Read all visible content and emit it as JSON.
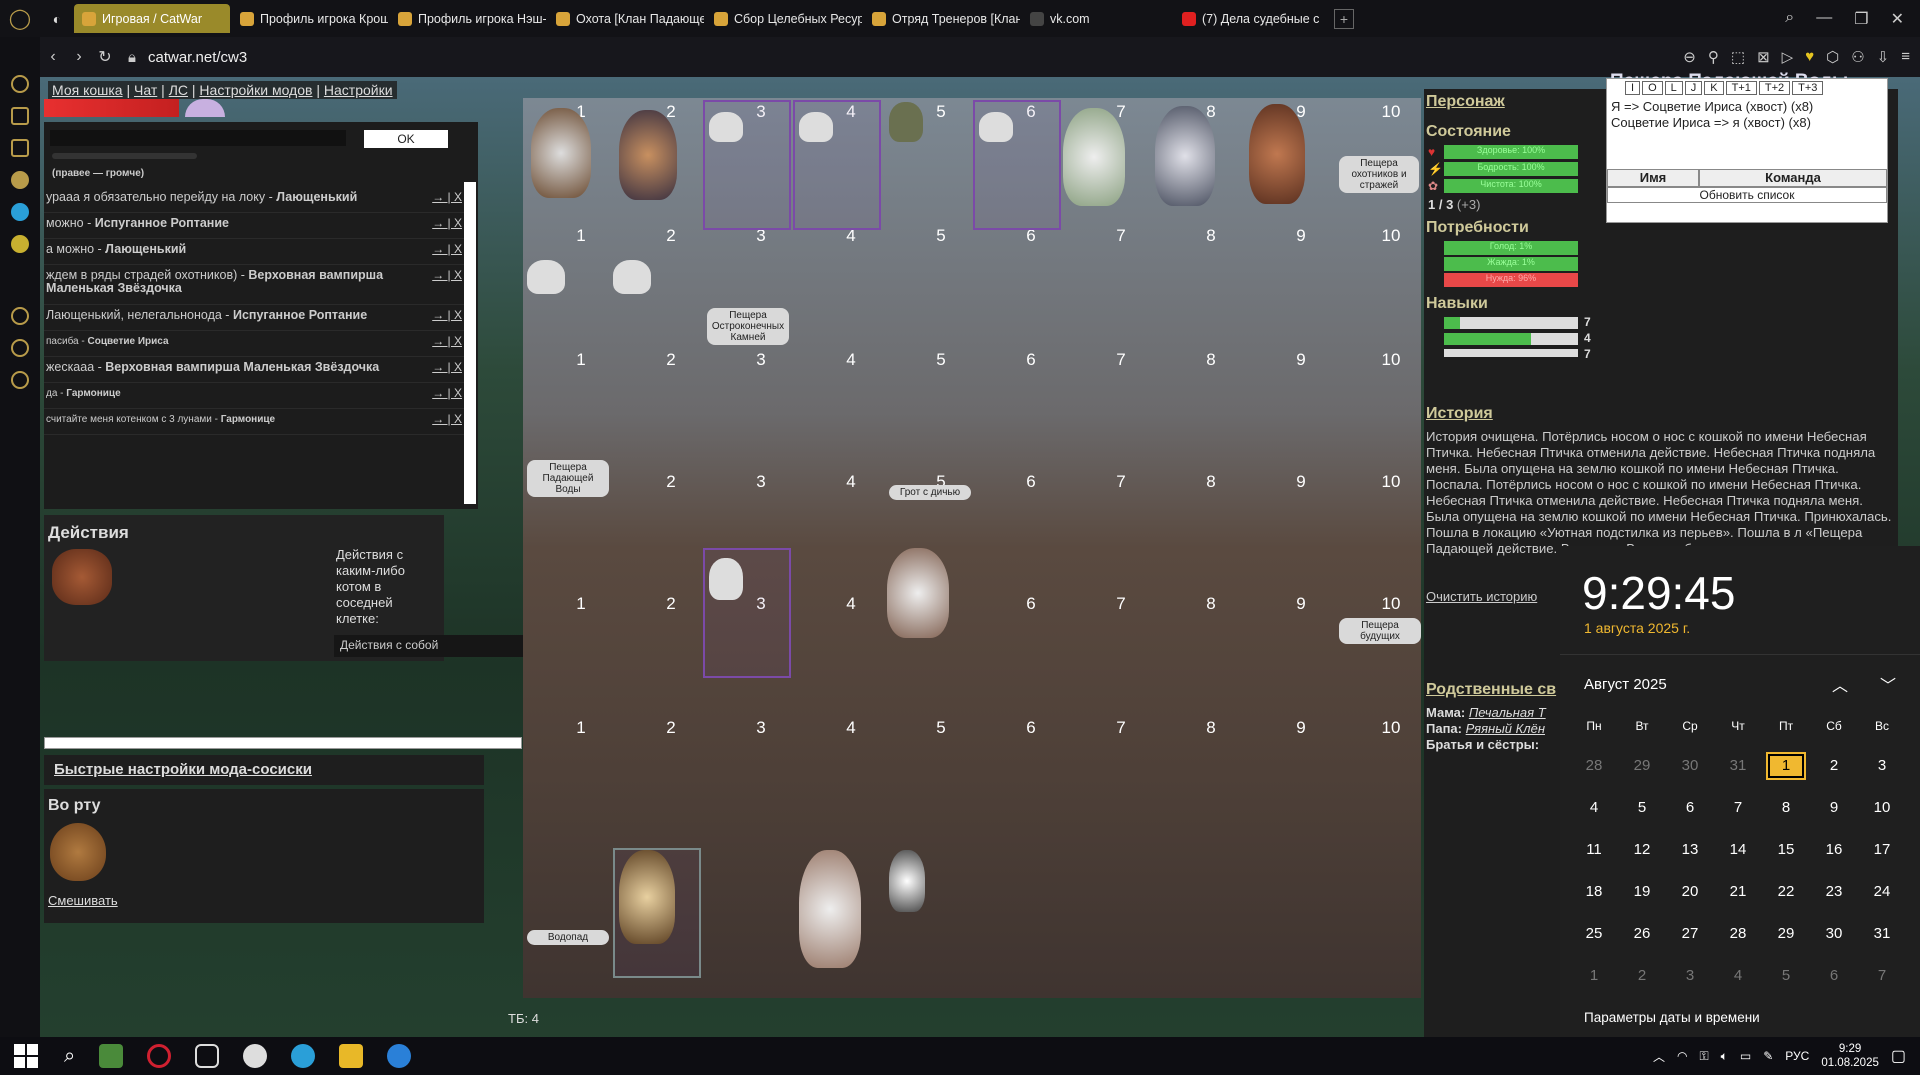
{
  "browser": {
    "tabs": [
      {
        "label": "Игровая / CatWar",
        "active": true,
        "color": "#d8a43a"
      },
      {
        "label": "Профиль игрока Крошка",
        "active": false,
        "color": "#d8a43a"
      },
      {
        "label": "Профиль игрока Нэш-Ко",
        "active": false,
        "color": "#d8a43a"
      },
      {
        "label": "Охота [Клан Падающей В",
        "active": false,
        "color": "#d8a43a"
      },
      {
        "label": "Сбор Целебных Ресурсо",
        "active": false,
        "color": "#d8a43a"
      },
      {
        "label": "Отряд Тренеров [Клан П",
        "active": false,
        "color": "#d8a43a"
      },
      {
        "label": "vk.com",
        "active": false,
        "color": "#444"
      },
      {
        "label": "(7) Дела судебные с",
        "active": false,
        "color": "#e02020"
      }
    ],
    "url": "catwar.net/cw3"
  },
  "topnav": [
    "Моя кошка",
    "Чат",
    "ЛС",
    "Настройки модов",
    "Настройки"
  ],
  "chat": {
    "ok_label": "OK",
    "volume_hint": "(правее — громче)",
    "messages": [
      {
        "text": "урааа я обязательно перейду на локу - ",
        "author": "Лающенький"
      },
      {
        "text": "можно - ",
        "author": "Испуганное Роптание"
      },
      {
        "text": "а можно - ",
        "author": "Лающенький"
      },
      {
        "text": "ждем в ряды страдей охотников) - ",
        "author": "Верховная вампирша Маленькая Звёздочка"
      },
      {
        "text": "Лающенький, нелегальнонода - ",
        "author": "Испуганное Роптание"
      },
      {
        "text": "пасиба - ",
        "author": "Соцветие Ириса"
      },
      {
        "text": "жескааа - ",
        "author": "Верховная вампирша Маленькая Звёздочка"
      },
      {
        "text": "да - ",
        "author": "Гармонице"
      },
      {
        "text": "считайте меня котенком с 3 лунами - ",
        "author": "Гармонице"
      }
    ],
    "action_icons": "→ | X"
  },
  "actions": {
    "title": "Действия",
    "desc": "Действия с каким-либо котом в соседней клетке:",
    "self_button": "Действия с собой"
  },
  "mod_settings": "Быстрые настройки мода-сосиски",
  "mouth": {
    "title": "Во рту",
    "mix": "Смешивать"
  },
  "field": {
    "row_numbers": [
      "1",
      "2",
      "3",
      "4",
      "5",
      "6",
      "7",
      "8",
      "9",
      "10"
    ],
    "locations": [
      "Пещера охотников и стражей",
      "Пещера Остроконечных Камней",
      "Пещера Падающей Воды",
      "Грот с дичью",
      "Пещера будущих",
      "Водопад"
    ],
    "tb": "ТБ: 4"
  },
  "character": {
    "title": "Персонаж",
    "state": "Состояние",
    "health": "Здоровье: 100%",
    "energy": "Бодрость: 100%",
    "clean": "Чистота: 100%",
    "count": "1 / 3",
    "count_extra": "(+3)",
    "needs": "Потребности",
    "hunger": "Голод: 1%",
    "thirst": "Жажда: 1%",
    "need": "Нужда: 96%",
    "skills": "Навыки",
    "skill_values": [
      "7",
      "4",
      "7"
    ],
    "history": "История",
    "history_text": "История очищена. Потёрлись носом о нос с кошкой по имени Небесная Птичка. Небесная Птичка отменила действие. Небесная Птичка подняла меня. Была опущена на землю кошкой по имени Небесная Птичка. Поспала. Потёрлись носом о нос с кошкой по имени Небесная Птичка. Небесная Птичка отменила действие. Небесная Птичка подняла меня. Была опущена на землю кошкой по имени Небесная Птичка. Принюхалась. Пошла в локацию «Уютная подстилка из перьев». Пошла в л «Пещера Падающей действие. Вылизала Встала в боевую сто",
    "clear_history": "Очистить историю",
    "relatives": "Родственные св",
    "mother_label": "Мама:",
    "mother": "Печальная Т",
    "father_label": "Папа:",
    "father": "Ряяный Клён",
    "siblings_label": "Братья и сёстры:"
  },
  "loc_title": "Пещера Падающей Воды",
  "minichat": {
    "buttons": [
      "I",
      "O",
      "L",
      "J",
      "K",
      "T+1",
      "T+2",
      "T+3"
    ],
    "lines": [
      "Я => Соцветие Ириса (хвост) (x8)",
      "Соцветие Ириса => я (хвост) (x8)"
    ],
    "col_name": "Имя",
    "col_team": "Команда",
    "refresh": "Обновить список"
  },
  "calendar": {
    "time": "9:29:45",
    "date": "1 августа 2025 г.",
    "month": "Август 2025",
    "weekdays": [
      "Пн",
      "Вт",
      "Ср",
      "Чт",
      "Пт",
      "Сб",
      "Вс"
    ],
    "days": [
      "28",
      "29",
      "30",
      "31",
      "1",
      "2",
      "3",
      "4",
      "5",
      "6",
      "7",
      "8",
      "9",
      "10",
      "11",
      "12",
      "13",
      "14",
      "15",
      "16",
      "17",
      "18",
      "19",
      "20",
      "21",
      "22",
      "23",
      "24",
      "25",
      "26",
      "27",
      "28",
      "29",
      "30",
      "31",
      "1",
      "2",
      "3",
      "4",
      "5",
      "6",
      "7"
    ],
    "settings": "Параметры даты и времени"
  },
  "taskbar": {
    "lang": "РУС",
    "time": "9:29",
    "date": "01.08.2025"
  }
}
